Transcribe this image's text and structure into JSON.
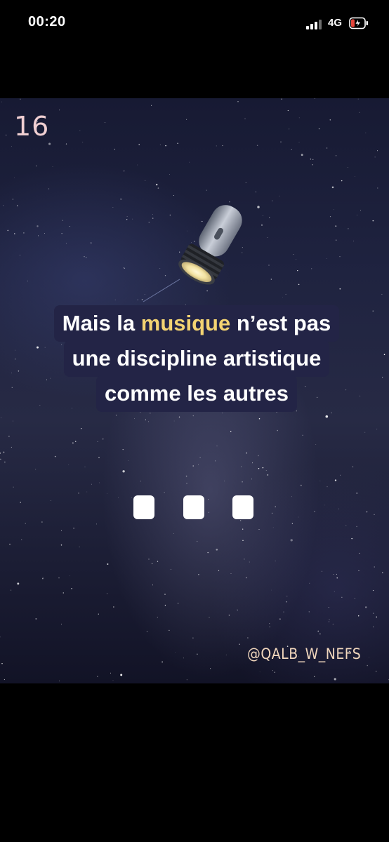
{
  "status_bar": {
    "time": "00:20",
    "network": "4G",
    "signal_bars_active": 3,
    "battery_level": 0.2,
    "battery_charging": true,
    "battery_color": "#e5453a"
  },
  "story": {
    "number": "16",
    "icon": "flashlight-icon",
    "caption": {
      "line1_before": "Mais la ",
      "line1_highlight": "musique",
      "line1_after": " n’est pas",
      "line2": "une discipline artistique",
      "line3": "comme les autres"
    },
    "highlight_color": "#f3d372",
    "placeholder_icons": [
      "white-square-icon",
      "white-square-icon",
      "white-square-icon"
    ],
    "handle": "@QALB_W_NEFS"
  }
}
